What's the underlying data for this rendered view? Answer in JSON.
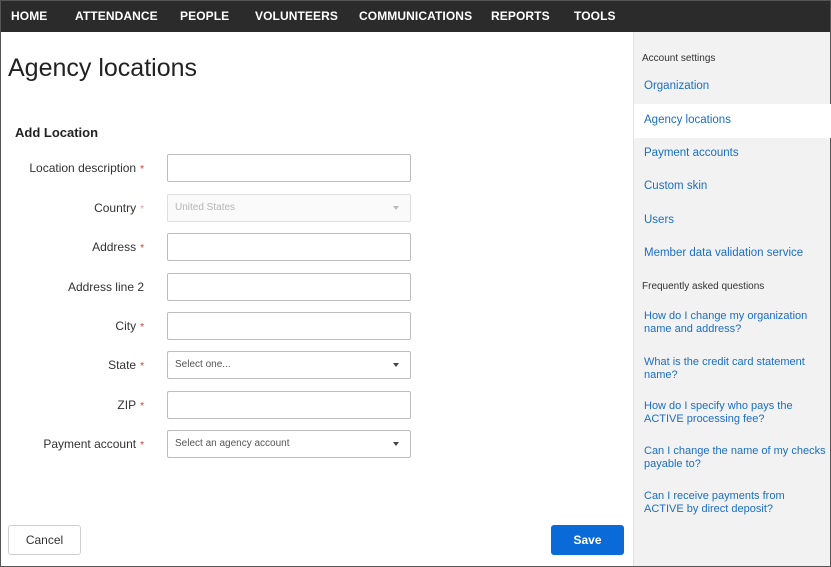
{
  "nav": {
    "items": [
      "HOME",
      "ATTENDANCE",
      "PEOPLE",
      "VOLUNTEERS",
      "COMMUNICATIONS",
      "REPORTS",
      "TOOLS"
    ]
  },
  "page": {
    "title": "Agency locations",
    "section_title": "Add Location"
  },
  "form": {
    "location_description": {
      "label": "Location description",
      "value": ""
    },
    "country": {
      "label": "Country",
      "selected": "United States"
    },
    "address": {
      "label": "Address",
      "value": ""
    },
    "address2": {
      "label": "Address line 2",
      "value": ""
    },
    "city": {
      "label": "City",
      "value": ""
    },
    "state": {
      "label": "State",
      "selected": "Select one..."
    },
    "zip": {
      "label": "ZIP",
      "value": ""
    },
    "payment_account": {
      "label": "Payment account",
      "selected": "Select an agency account"
    },
    "required_mark": "*"
  },
  "actions": {
    "cancel_label": "Cancel",
    "save_label": "Save"
  },
  "sidebar": {
    "account_heading": "Account settings",
    "links": [
      "Organization",
      "Agency locations",
      "Payment accounts",
      "Custom skin",
      "Users",
      "Member data validation service"
    ],
    "active_link": "Agency locations",
    "faq_heading": "Frequently asked questions",
    "faqs": [
      "How do I change my organization name and address?",
      "What is the credit card statement name?",
      "How do I specify who pays the ACTIVE processing fee?",
      "Can I change the name of my checks payable to?",
      "Can I receive payments from ACTIVE by direct deposit?"
    ]
  },
  "colors": {
    "nav_bg": "#2b2b2b",
    "link": "#1a6fc4",
    "primary_button": "#0a6bd8",
    "required": "#d33333",
    "sidebar_bg": "#f2f2f2"
  }
}
